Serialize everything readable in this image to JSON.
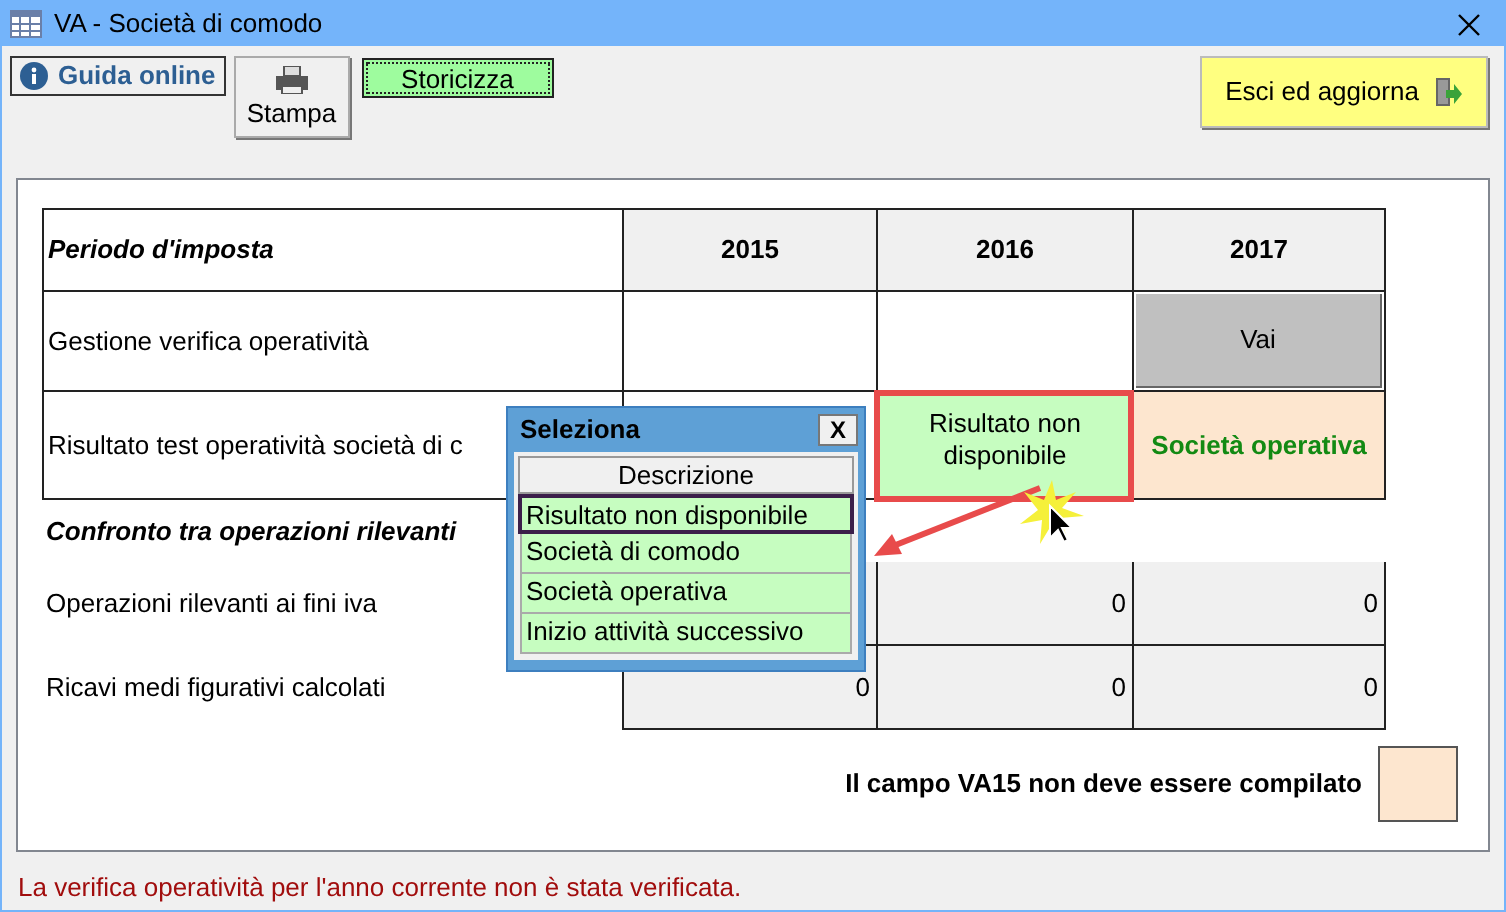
{
  "window": {
    "title": "VA - Società di comodo"
  },
  "toolbar": [
    {
      "kind": "info",
      "label": "Guida online"
    },
    {
      "kind": "print",
      "label": "Stampa"
    },
    {
      "kind": "green",
      "label": "Storicizza"
    }
  ],
  "exit_button": {
    "label": "Esci ed aggiorna"
  },
  "table": {
    "header": "Periodo d'imposta",
    "columns": [
      "2015",
      "2016",
      "2017"
    ],
    "rows": [
      {
        "kind": "plain",
        "label": "Gestione verifica operatività",
        "cells": [
          null,
          null,
          {
            "kind": "button",
            "text": "Vai"
          }
        ]
      },
      {
        "kind": "plain",
        "label": "Risultato test operatività società di c",
        "cells": [
          null,
          {
            "kind": "highlight",
            "text": "Risultato non disponibile"
          },
          {
            "kind": "result",
            "text": "Società operativa"
          }
        ]
      },
      {
        "kind": "heading",
        "label": "Confronto tra operazioni rilevanti"
      },
      {
        "kind": "numeric",
        "label": "Operazioni rilevanti ai fini iva",
        "cells": [
          null,
          {
            "kind": "number",
            "text": "0"
          },
          {
            "kind": "number",
            "text": "0"
          }
        ]
      },
      {
        "kind": "numeric",
        "label": "Ricavi medi figurativi calcolati",
        "cells": [
          {
            "kind": "number",
            "text": "0"
          },
          {
            "kind": "number",
            "text": "0"
          },
          {
            "kind": "number",
            "text": "0"
          }
        ]
      }
    ]
  },
  "va15_note": "Il campo VA15 non deve essere compilato",
  "status_message": "La verifica operatività per l'anno corrente non è stata verificata.",
  "popup": {
    "title": "Seleziona",
    "close": "X",
    "column": "Descrizione",
    "items": [
      {
        "label": "Risultato non disponibile",
        "selected": true
      },
      {
        "label": "Società di comodo",
        "selected": false
      },
      {
        "label": "Società operativa",
        "selected": false
      },
      {
        "label": "Inizio attività successivo",
        "selected": false
      }
    ]
  }
}
